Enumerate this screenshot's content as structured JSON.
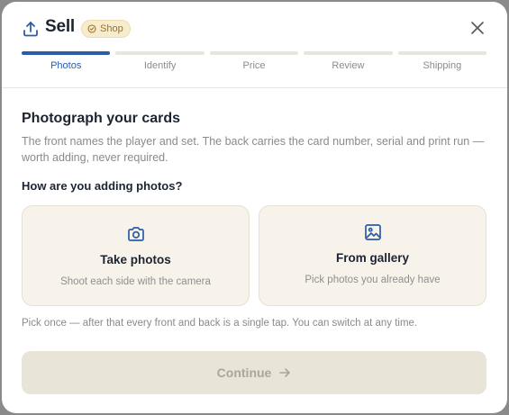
{
  "header": {
    "title": "Sell",
    "badge": "Shop",
    "icons": {
      "title": "upload-icon",
      "badge": "shop-icon",
      "close": "close-icon"
    }
  },
  "steps": [
    {
      "label": "Photos",
      "active": true
    },
    {
      "label": "Identify",
      "active": false
    },
    {
      "label": "Price",
      "active": false
    },
    {
      "label": "Review",
      "active": false
    },
    {
      "label": "Shipping",
      "active": false
    }
  ],
  "content": {
    "title": "Photograph your cards",
    "description": "The front names the player and set. The back carries the card number, serial and print run — worth adding, never required.",
    "question": "How are you adding photos?",
    "options": [
      {
        "title": "Take photos",
        "subtitle": "Shoot each side with the camera",
        "icon": "camera-icon"
      },
      {
        "title": "From gallery",
        "subtitle": "Pick photos you already have",
        "icon": "image-icon"
      }
    ],
    "hint": "Pick once — after that every front and back is a single tap. You can switch at any time."
  },
  "footer": {
    "continue_label": "Continue",
    "continue_icon": "arrow-right-icon"
  },
  "colors": {
    "accent": "#2b5ca8",
    "badge_bg": "#f8eccf",
    "badge_text": "#9a7226",
    "option_bg": "#f7f3ea",
    "button_disabled_bg": "#e8e4d8",
    "button_disabled_text": "#a9a69b"
  }
}
